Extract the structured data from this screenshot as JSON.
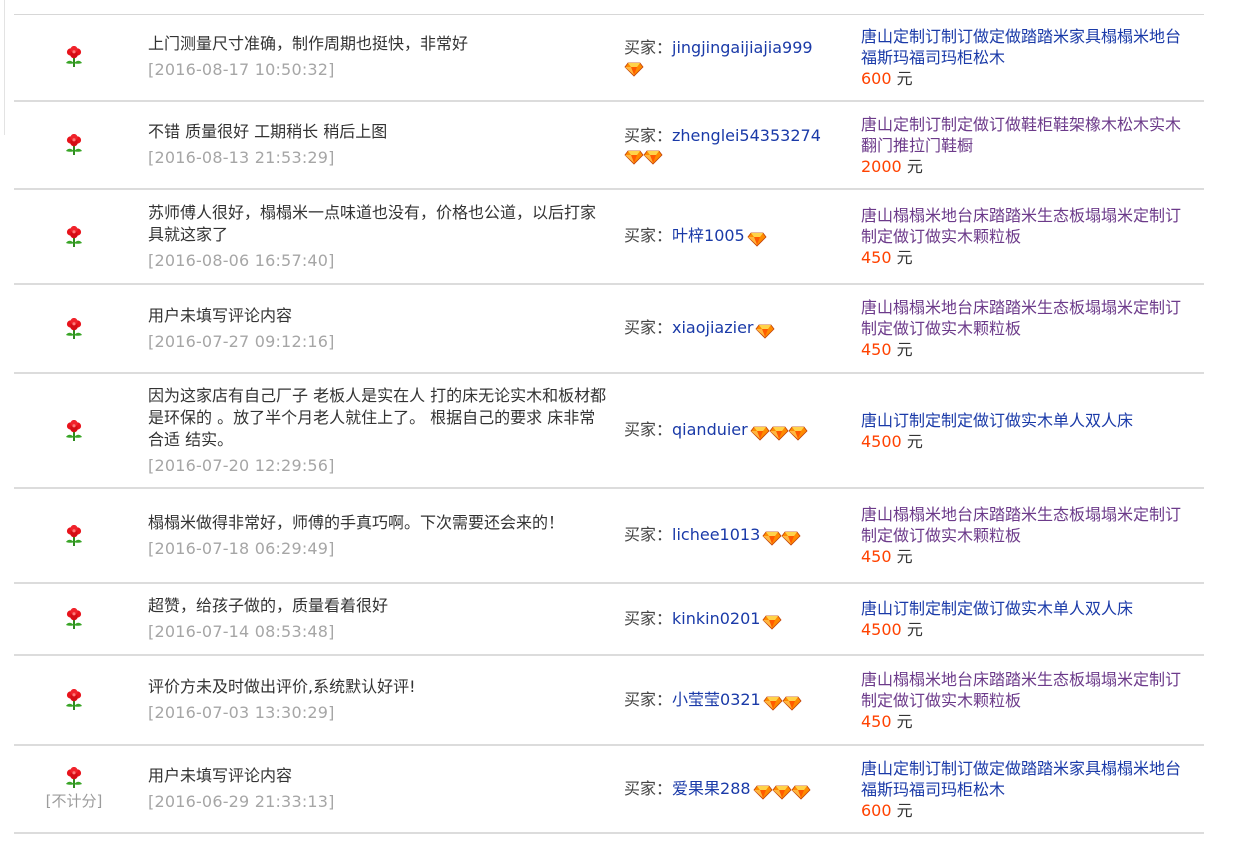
{
  "buyer_label": "买家：",
  "currency": "元",
  "colors": {
    "link": "#1a3aa8",
    "visited_link": "#6c3a8a",
    "price": "#ff4200",
    "date": "#a6a6a6"
  },
  "reviews": [
    {
      "rating_icon": "flower-icon",
      "rating_note": "",
      "comment": "上门测量尺寸准确，制作周期也挺快，非常好",
      "date": "[2016-08-17 10:50:32]",
      "buyer": "jingjingaijiajia999",
      "buyer_gems": 1,
      "item_title": "唐山定制订制订做定做踏踏米家具榻榻米地台福斯玛福司玛柜松木",
      "item_visited": false,
      "price": "600"
    },
    {
      "rating_icon": "flower-icon",
      "rating_note": "",
      "comment": "不错 质量很好 工期稍长 稍后上图",
      "date": "[2016-08-13 21:53:29]",
      "buyer": "zhenglei54353274",
      "buyer_gems": 2,
      "item_title": "唐山定制订制定做订做鞋柜鞋架橡木松木实木翻门推拉门鞋橱",
      "item_visited": true,
      "price": "2000"
    },
    {
      "rating_icon": "flower-icon",
      "rating_note": "",
      "comment": "苏师傅人很好，榻榻米一点味道也没有，价格也公道，以后打家具就这家了",
      "date": "[2016-08-06 16:57:40]",
      "buyer": "叶梓1005",
      "buyer_gems": 1,
      "item_title": "唐山榻榻米地台床踏踏米生态板塌塌米定制订制定做订做实木颗粒板",
      "item_visited": true,
      "price": "450"
    },
    {
      "rating_icon": "flower-icon",
      "rating_note": "",
      "comment": "用户未填写评论内容",
      "date": "[2016-07-27 09:12:16]",
      "buyer": "xiaojiazier",
      "buyer_gems": 1,
      "item_title": "唐山榻榻米地台床踏踏米生态板塌塌米定制订制定做订做实木颗粒板",
      "item_visited": true,
      "price": "450"
    },
    {
      "rating_icon": "flower-icon",
      "rating_note": "",
      "comment": "因为这家店有自己厂子 老板人是实在人 打的床无论实木和板材都是环保的 。放了半个月老人就住上了。 根据自己的要求 床非常合适 结实。",
      "date": "[2016-07-20 12:29:56]",
      "buyer": "qianduier",
      "buyer_gems": 3,
      "item_title": "唐山订制定制定做订做实木单人双人床",
      "item_visited": false,
      "price": "4500"
    },
    {
      "rating_icon": "flower-icon",
      "rating_note": "",
      "comment": "榻榻米做得非常好，师傅的手真巧啊。下次需要还会来的！",
      "date": "[2016-07-18 06:29:49]",
      "buyer": "lichee1013",
      "buyer_gems": 2,
      "item_title": "唐山榻榻米地台床踏踏米生态板塌塌米定制订制定做订做实木颗粒板",
      "item_visited": true,
      "price": "450"
    },
    {
      "rating_icon": "flower-icon",
      "rating_note": "",
      "comment": "超赞，给孩子做的，质量看着很好",
      "date": "[2016-07-14 08:53:48]",
      "buyer": "kinkin0201",
      "buyer_gems": 1,
      "item_title": "唐山订制定制定做订做实木单人双人床",
      "item_visited": false,
      "price": "4500"
    },
    {
      "rating_icon": "flower-icon",
      "rating_note": "",
      "comment": "评价方未及时做出评价,系统默认好评!",
      "date": "[2016-07-03 13:30:29]",
      "buyer": "小莹莹0321",
      "buyer_gems": 2,
      "item_title": "唐山榻榻米地台床踏踏米生态板塌塌米定制订制定做订做实木颗粒板",
      "item_visited": true,
      "price": "450"
    },
    {
      "rating_icon": "flower-icon",
      "rating_note": "[不计分]",
      "comment": "用户未填写评论内容",
      "date": "[2016-06-29 21:33:13]",
      "buyer": "爱果果288",
      "buyer_gems": 3,
      "item_title": "唐山定制订制订做定做踏踏米家具榻榻米地台福斯玛福司玛柜松木",
      "item_visited": false,
      "price": "600"
    }
  ]
}
